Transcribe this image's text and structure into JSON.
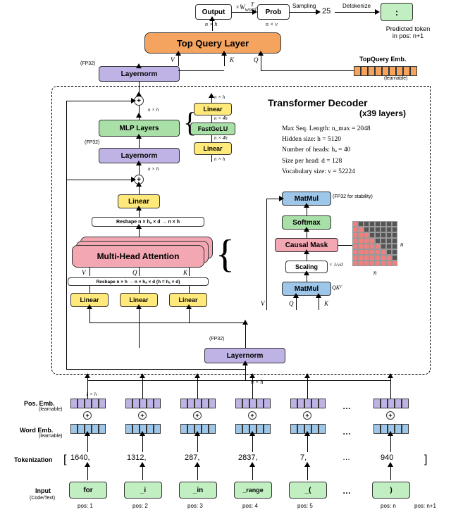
{
  "top": {
    "output": "Output",
    "prob": "Prob",
    "times_w": "×W",
    "word_T": "word",
    "sup_T": "T",
    "sampling": "Sampling",
    "sample_val": "25",
    "detok": "Detokenize",
    "pred_token": ":",
    "pred_caption1": "Predicted token",
    "pred_caption2": "in pos: n+1",
    "nxh": "n × h",
    "nxv": "n × v"
  },
  "blocks": {
    "topquery": "Top Query Layer",
    "layernorm": "Layernorm",
    "mlp": "MLP Layers",
    "linear": "Linear",
    "fastgelu": "FastGeLU",
    "mha": "Multi-Head Attention",
    "matmul": "MatMul",
    "softmax": "Softmax",
    "causal": "Causal Mask",
    "scaling": "Scaling",
    "fp32": "(FP32)",
    "fp32stab": "(FP32 for stability)",
    "reshape1": "Reshape   n × hₐ × d → n × h",
    "reshape2": "Reshape   n × h → n × hₐ × d  (h = hₐ × d)"
  },
  "letters": {
    "V": "V",
    "K": "K",
    "Q": "Q",
    "n": "n"
  },
  "side": {
    "title": "Transformer Decoder",
    "subtitle": "(x39 layers)",
    "rows": [
      "Max Seq. Length: n_max = 2048",
      "Hidden size: h = 5120",
      "Number of heads: hₐ = 40",
      "Size per head: d = 128",
      "Vocabulary size: v = 52224"
    ],
    "topq_emb": "TopQuery Emb.",
    "learnable": "(learnable)"
  },
  "dims": {
    "nxh": "n × h",
    "nx4h": "n × 4h",
    "scale": "× 1/√d",
    "qkt": "QKᵀ"
  },
  "bottom": {
    "pos_emb": "Pos. Emb.",
    "word_emb": "Word Emb.",
    "tokenization": "Tokenization",
    "input": "Input",
    "input_sub": "(Code/Text)",
    "learnable": "(learnable)",
    "tokens": [
      "1640,",
      "1312,",
      "287,",
      "2837,",
      "7,",
      "…",
      "940"
    ],
    "open_br": "[",
    "close_br": "]",
    "words": [
      "for",
      "_i",
      "_in",
      "_range",
      "_(",
      "…",
      ")"
    ],
    "pos": [
      "pos: 1",
      "pos: 2",
      "pos: 3",
      "pos: 4",
      "pos: 5",
      "pos: n",
      "pos: n+1"
    ],
    "onexh": "1 × h"
  }
}
